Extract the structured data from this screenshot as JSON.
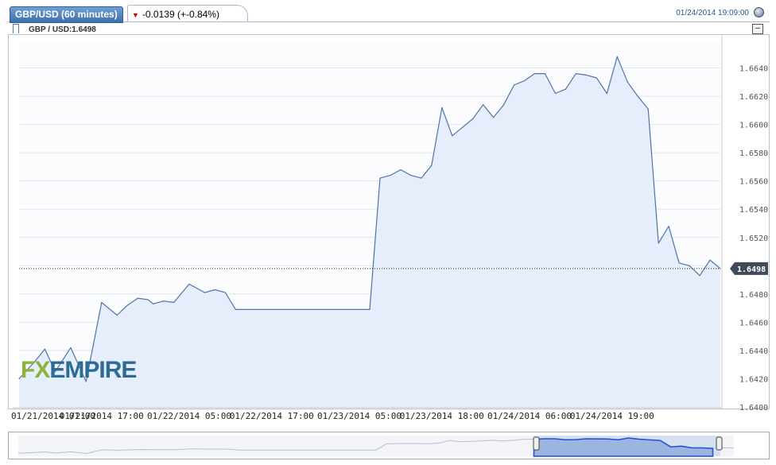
{
  "header": {
    "symbol_tab": "GBP/USD (60 minutes)",
    "change_text": "-0.0139 (+-0.84%)",
    "datetime": "01/24/2014 19:09:00"
  },
  "legend": {
    "label": "GBP / USD:1.6498"
  },
  "colors": {
    "line": "#4f73a8",
    "fill": "#e6eefb",
    "accent_tab": "#3d6fae",
    "down": "#cc0000"
  },
  "logo": {
    "part1": "FX",
    "part2": "EMPIRE"
  },
  "chart_data": {
    "type": "area",
    "title": "",
    "series": [
      {
        "name": "GBP / USD",
        "x": [
          0,
          3,
          5,
          7,
          10,
          13,
          16,
          19,
          21,
          23,
          25,
          26,
          28,
          30,
          33,
          36,
          38,
          40,
          42,
          44,
          46,
          48,
          50,
          52,
          54,
          56,
          58,
          60,
          62,
          64,
          66,
          68,
          70,
          72,
          74,
          76,
          78,
          80,
          82,
          84,
          86,
          88,
          90,
          92,
          94,
          96,
          98,
          100,
          102,
          104,
          106,
          108,
          110,
          112,
          114,
          116,
          118,
          120,
          122,
          124,
          126,
          128,
          130,
          132,
          134,
          136
        ],
        "y": [
          1.642,
          1.6432,
          1.6441,
          1.6425,
          1.6442,
          1.6418,
          1.6474,
          1.6465,
          1.6472,
          1.6477,
          1.6476,
          1.6473,
          1.6475,
          1.6474,
          1.6487,
          1.6481,
          1.6483,
          1.6481,
          1.6469,
          1.6469,
          1.6469,
          1.6469,
          1.6469,
          1.6469,
          1.6469,
          1.6469,
          1.6469,
          1.6469,
          1.6469,
          1.6469,
          1.6469,
          1.6469,
          1.6562,
          1.6564,
          1.6568,
          1.6564,
          1.6562,
          1.6571,
          1.6612,
          1.6592,
          1.6598,
          1.6604,
          1.6614,
          1.6605,
          1.6614,
          1.6628,
          1.6631,
          1.6636,
          1.6636,
          1.6622,
          1.6625,
          1.6636,
          1.6635,
          1.6633,
          1.6622,
          1.6648,
          1.663,
          1.662,
          1.6611,
          1.6516,
          1.6528,
          1.6502,
          1.65,
          1.6493,
          1.6504,
          1.6498
        ]
      }
    ],
    "ylim": [
      1.64,
      1.666
    ],
    "yticks": [
      "1.6400",
      "1.6420",
      "1.6440",
      "1.6460",
      "1.6480",
      "1.6500",
      "1.6520",
      "1.6540",
      "1.6560",
      "1.6580",
      "1.6600",
      "1.6620",
      "1.6640"
    ],
    "xlim": [
      0,
      136
    ],
    "xticks": [
      {
        "x": 0,
        "label": "01/21/2014 01:00"
      },
      {
        "x": 16,
        "label": "01/21/2014 17:00"
      },
      {
        "x": 33,
        "label": "01/22/2014 05:00"
      },
      {
        "x": 49,
        "label": "01/22/2014 17:00"
      },
      {
        "x": 66,
        "label": "01/23/2014 05:00"
      },
      {
        "x": 82,
        "label": "01/23/2014 18:00"
      },
      {
        "x": 99,
        "label": "01/24/2014 06:00"
      },
      {
        "x": 115,
        "label": "01/24/2014 19:00"
      }
    ],
    "last_value": "1.6498",
    "last_value_num": 1.6498,
    "grid": true
  }
}
